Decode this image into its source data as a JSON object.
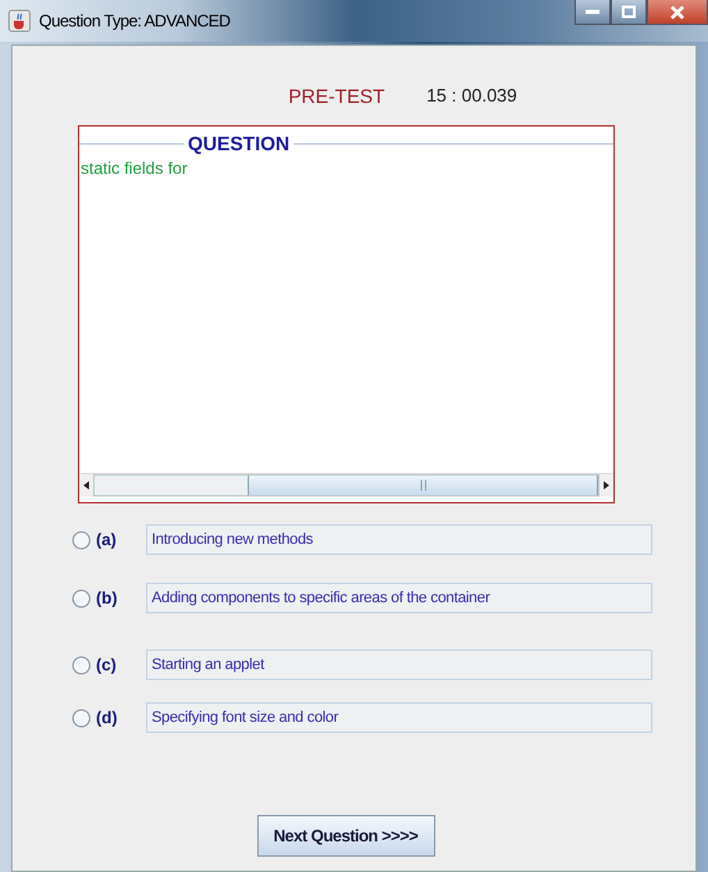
{
  "window": {
    "title": "Question Type: ADVANCED"
  },
  "header": {
    "test_label": "PRE-TEST",
    "timer": "15 : 00.039"
  },
  "question": {
    "heading": "QUESTION",
    "text": "static fields for"
  },
  "options": [
    {
      "label": "(a)",
      "text": "Introducing new methods",
      "selected": false
    },
    {
      "label": "(b)",
      "text": "Adding components to specific areas of the container",
      "selected": false
    },
    {
      "label": "(c)",
      "text": "Starting an applet",
      "selected": false
    },
    {
      "label": "(d)",
      "text": "Specifying font size and color",
      "selected": false
    }
  ],
  "next_button": "Next Question >>>>"
}
